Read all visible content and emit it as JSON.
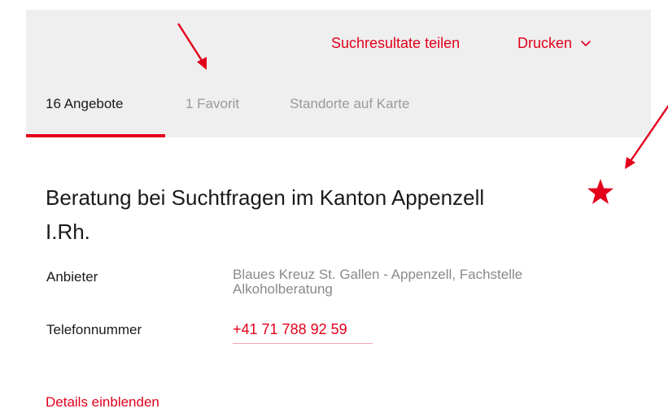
{
  "header": {
    "share_label": "Suchresultate teilen",
    "print_label": "Drucken"
  },
  "tabs": [
    {
      "label": "16 Angebote",
      "active": true
    },
    {
      "label": "1 Favorit",
      "active": false
    },
    {
      "label": "Standorte auf Karte",
      "active": false
    }
  ],
  "result": {
    "title": "Beratung bei Suchtfragen im Kanton Appenzell I.Rh.",
    "favorite": true,
    "provider_label": "Anbieter",
    "provider_value": "Blaues Kreuz St. Gallen - Appenzell, Fachstelle Alkoholberatung",
    "phone_label": "Telefonnummer",
    "phone_value": "+41 71 788 92 59",
    "details_label": "Details einblenden"
  },
  "colors": {
    "accent": "#e3001b",
    "header_bg": "#efefef",
    "muted_text": "#9a9a9a",
    "text": "#1a1a1a"
  },
  "icons": {
    "dropdown": "chevron-down-icon",
    "favorite": "star-icon",
    "annotation": "arrow-icon"
  }
}
